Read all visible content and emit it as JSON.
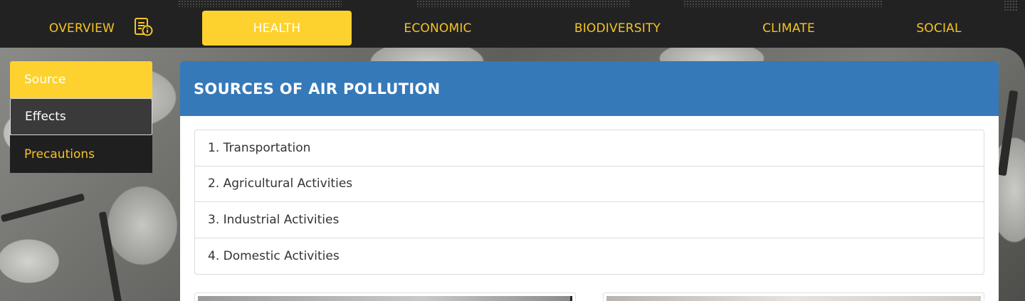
{
  "nav": {
    "items": [
      {
        "label": "OVERVIEW"
      },
      {
        "label": "HEALTH"
      },
      {
        "label": "ECONOMIC"
      },
      {
        "label": "BIODIVERSITY"
      },
      {
        "label": "CLIMATE"
      },
      {
        "label": "SOCIAL"
      }
    ],
    "active": "HEALTH",
    "overview_icon": "document-info-icon"
  },
  "side_menu": {
    "items": [
      {
        "label": "Source"
      },
      {
        "label": "Effects"
      },
      {
        "label": "Precautions"
      }
    ],
    "active": "Source"
  },
  "main": {
    "title": "SOURCES OF AIR POLLUTION",
    "sources": [
      {
        "label": "1. Transportation"
      },
      {
        "label": "2. Agricultural Activities"
      },
      {
        "label": "3. Industrial Activities"
      },
      {
        "label": "4. Domestic Activities"
      }
    ]
  },
  "colors": {
    "nav_bg": "#222222",
    "accent_yellow": "#fdd22f",
    "nav_text": "#f5c425",
    "header_blue": "#3579b8"
  }
}
